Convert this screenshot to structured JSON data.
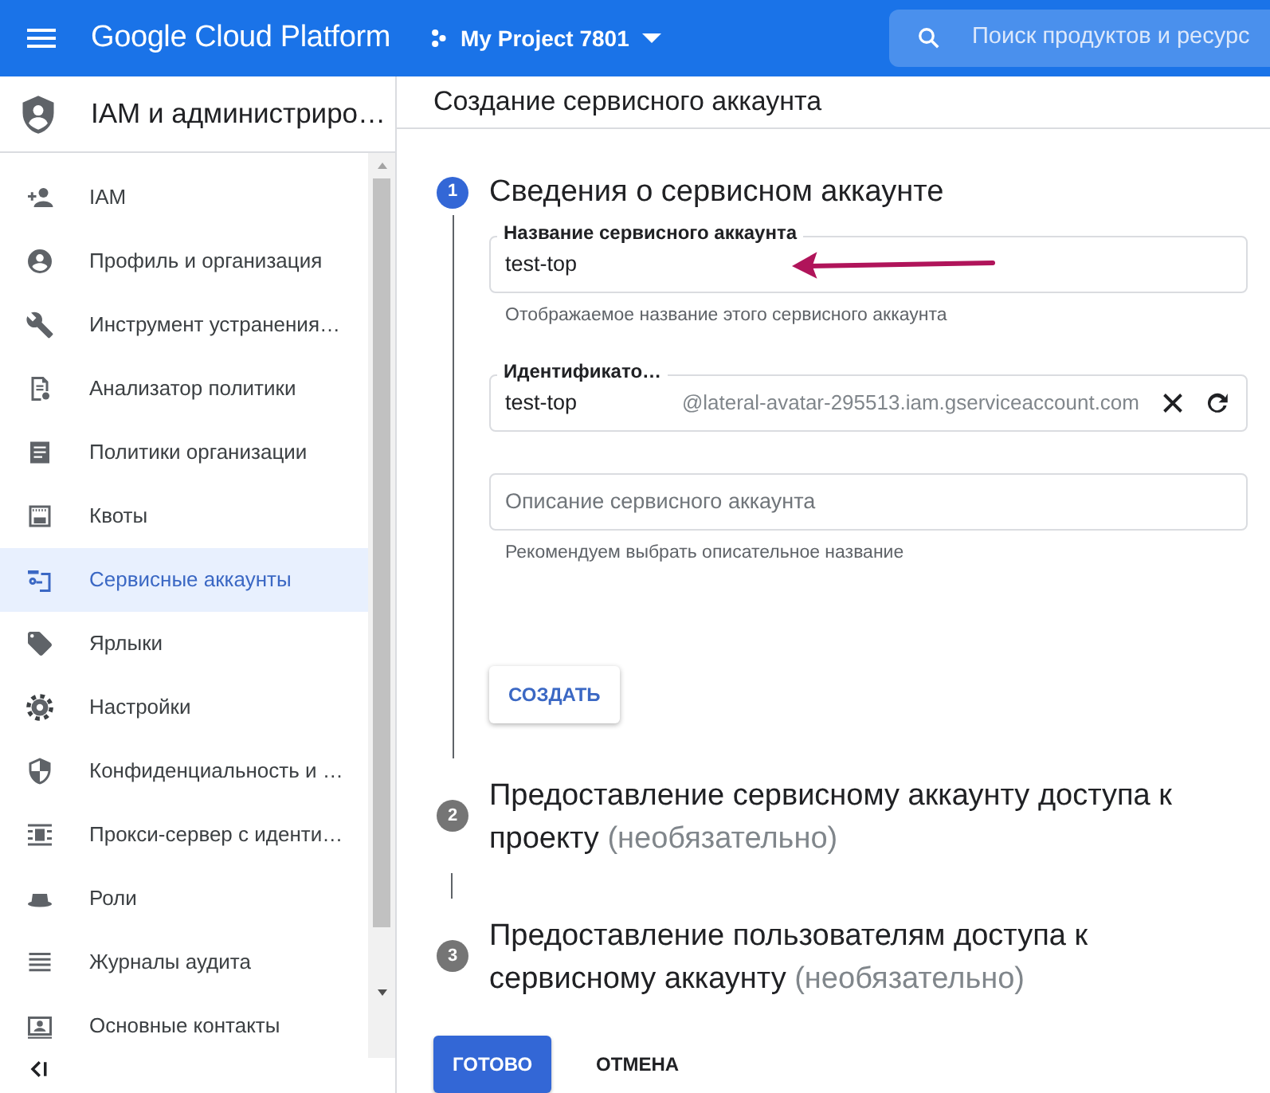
{
  "topbar": {
    "title": "Google Cloud Platform",
    "project": "My Project 7801",
    "search": {
      "placeholder": "Поиск продуктов и ресурс"
    }
  },
  "sidebar": {
    "title": "IAM и администриро…",
    "items": [
      {
        "label": "IAM",
        "selected": false
      },
      {
        "label": "Профиль и организация",
        "selected": false
      },
      {
        "label": "Инструмент устранения…",
        "selected": false
      },
      {
        "label": "Анализатор политики",
        "selected": false
      },
      {
        "label": "Политики организации",
        "selected": false
      },
      {
        "label": "Квоты",
        "selected": false
      },
      {
        "label": "Сервисные аккаунты",
        "selected": true
      },
      {
        "label": "Ярлыки",
        "selected": false
      },
      {
        "label": "Настройки",
        "selected": false
      },
      {
        "label": "Конфиденциальность и …",
        "selected": false
      },
      {
        "label": "Прокси-сервер с иденти…",
        "selected": false
      },
      {
        "label": "Роли",
        "selected": false
      },
      {
        "label": "Журналы аудита",
        "selected": false
      },
      {
        "label": "Основные контакты",
        "selected": false
      }
    ]
  },
  "page_title": "Создание сервисного аккаунта",
  "steps": [
    {
      "number": "1",
      "title": "Сведения о сервисном аккаунте",
      "active": true,
      "fields": [
        {
          "kind": "text",
          "label": "Название сервисного аккаунта",
          "value": "test-top",
          "helper": "Отображаемое название этого сервисного аккаунта"
        },
        {
          "kind": "id",
          "label": "Идентификато…",
          "value": "test-top",
          "suffix": "@lateral-avatar-295513.iam.gserviceaccount.com"
        },
        {
          "kind": "text",
          "placeholder": "Описание сервисного аккаунта",
          "helper": "Рекомендуем выбрать описательное название"
        }
      ],
      "button": "СОЗДАТЬ"
    },
    {
      "number": "2",
      "title": "Предоставление сервисному аккаунту доступа к проекту",
      "optional": "(необязательно)",
      "active": false
    },
    {
      "number": "3",
      "title": "Предоставление пользователям доступа к сервисному аккаунту",
      "optional": "(необязательно)",
      "active": false
    }
  ],
  "actions": [
    {
      "label": "ГОТОВО",
      "kind": "primary"
    },
    {
      "label": "ОТМЕНА",
      "kind": "text"
    }
  ]
}
